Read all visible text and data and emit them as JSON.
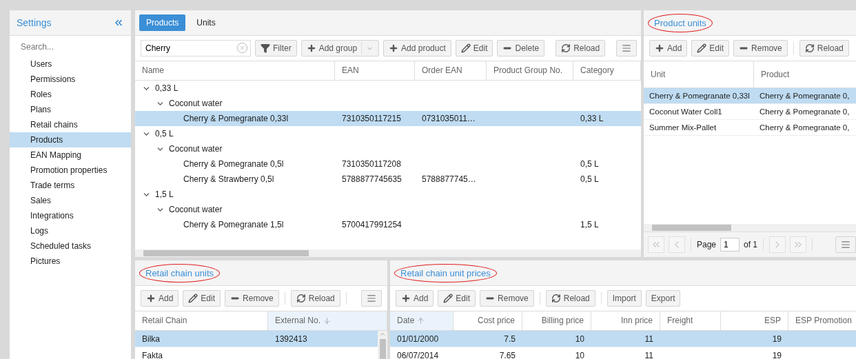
{
  "sidebar": {
    "title": "Settings",
    "search": {
      "placeholder": "Search..."
    },
    "items": [
      {
        "label": "Users",
        "selected": false
      },
      {
        "label": "Permissions",
        "selected": false
      },
      {
        "label": "Roles",
        "selected": false
      },
      {
        "label": "Plans",
        "selected": false
      },
      {
        "label": "Retail chains",
        "selected": false
      },
      {
        "label": "Products",
        "selected": true
      },
      {
        "label": "EAN Mapping",
        "selected": false
      },
      {
        "label": "Promotion properties",
        "selected": false
      },
      {
        "label": "Trade terms",
        "selected": false
      },
      {
        "label": "Sales",
        "selected": false
      },
      {
        "label": "Integrations",
        "selected": false
      },
      {
        "label": "Logs",
        "selected": false
      },
      {
        "label": "Scheduled tasks",
        "selected": false
      },
      {
        "label": "Pictures",
        "selected": false
      }
    ]
  },
  "products": {
    "tabs": [
      {
        "label": "Products",
        "selected": true
      },
      {
        "label": "Units",
        "selected": false
      }
    ],
    "search": {
      "value": "Cherry"
    },
    "toolbar": [
      {
        "kind": "filter",
        "label": "Filter"
      },
      {
        "kind": "add",
        "label": "Add group",
        "dropdown": true
      },
      {
        "kind": "add",
        "label": "Add product"
      },
      {
        "kind": "edit",
        "label": "Edit"
      },
      {
        "kind": "remove",
        "label": "Delete"
      },
      {
        "kind": "separator"
      },
      {
        "kind": "reload",
        "label": "Reload"
      },
      {
        "kind": "separator"
      },
      {
        "kind": "menu"
      }
    ],
    "columns": [
      {
        "label": "Name"
      },
      {
        "label": "EAN"
      },
      {
        "label": "Order EAN"
      },
      {
        "label": "Product Group No."
      },
      {
        "label": "Category"
      }
    ],
    "tree": [
      {
        "cells": [
          "0,33 L"
        ],
        "expanded": true,
        "children": [
          {
            "cells": [
              "Coconut water"
            ],
            "expanded": true,
            "children": [
              {
                "cells": [
                  "Cherry & Pomegranate 0,33l",
                  "7310350117215",
                  "0731035011…",
                  null,
                  "0,33 L"
                ],
                "selected": true
              }
            ]
          }
        ]
      },
      {
        "cells": [
          "0,5 L"
        ],
        "expanded": true,
        "children": [
          {
            "cells": [
              "Coconut water"
            ],
            "expanded": true,
            "children": [
              {
                "cells": [
                  "Cherry & Pomegranate 0,5l",
                  "7310350117208",
                  null,
                  null,
                  "0,5 L"
                ],
                "selected": false
              },
              {
                "cells": [
                  "Cherry & Strawberry 0,5l",
                  "5788877745635",
                  "5788877745…",
                  null,
                  "0,5 L"
                ],
                "selected": false
              }
            ]
          }
        ]
      },
      {
        "cells": [
          "1,5 L"
        ],
        "expanded": true,
        "children": [
          {
            "cells": [
              "Coconut water"
            ],
            "expanded": true,
            "children": [
              {
                "cells": [
                  "Cherry & Pomegranate 1,5l",
                  "5700417991254",
                  null,
                  null,
                  "1,5 L"
                ],
                "selected": false
              }
            ]
          }
        ]
      }
    ]
  },
  "product_units": {
    "title": "Product units",
    "annotated": true,
    "toolbar": [
      {
        "kind": "add",
        "label": "Add"
      },
      {
        "kind": "edit",
        "label": "Edit"
      },
      {
        "kind": "remove",
        "label": "Remove"
      },
      {
        "kind": "separator"
      },
      {
        "kind": "reload",
        "label": "Reload"
      }
    ],
    "columns": [
      {
        "label": "Unit"
      },
      {
        "label": "Product"
      }
    ],
    "rows": [
      {
        "cells": [
          "Cherry & Pomegranate 0,33l",
          "Cherry & Pomegranate 0,"
        ],
        "selected": true
      },
      {
        "cells": [
          "Coconut Water Coll1",
          "Cherry & Pomegranate 0,"
        ],
        "selected": false
      },
      {
        "cells": [
          "Summer Mix-Pallet",
          "Cherry & Pomegranate 0,"
        ],
        "selected": false
      }
    ],
    "pager": {
      "label": "Page",
      "page": "1",
      "total": "of 1"
    }
  },
  "retail_chain_units": {
    "title": "Retail chain units",
    "annotated": true,
    "toolbar": [
      {
        "kind": "add",
        "label": "Add"
      },
      {
        "kind": "edit",
        "label": "Edit"
      },
      {
        "kind": "remove",
        "label": "Remove"
      },
      {
        "kind": "separator"
      },
      {
        "kind": "reload",
        "label": "Reload"
      },
      {
        "kind": "separator"
      },
      {
        "kind": "menu"
      }
    ],
    "columns": [
      {
        "label": "Retail Chain"
      },
      {
        "label": "External No.",
        "sorted": true,
        "ascending": false
      }
    ],
    "rows": [
      {
        "cells": [
          "Bilka",
          "1392413"
        ],
        "selected": true
      },
      {
        "cells": [
          "Fakta",
          null
        ],
        "selected": false
      }
    ]
  },
  "retail_chain_unit_prices": {
    "title": "Retail chain unit prices",
    "annotated": true,
    "toolbar": [
      {
        "kind": "add",
        "label": "Add"
      },
      {
        "kind": "edit",
        "label": "Edit"
      },
      {
        "kind": "remove",
        "label": "Remove"
      },
      {
        "kind": "separator"
      },
      {
        "kind": "reload",
        "label": "Reload"
      },
      {
        "kind": "separator"
      },
      {
        "kind": "plain",
        "label": "Import"
      },
      {
        "kind": "plain",
        "label": "Export"
      }
    ],
    "columns": [
      {
        "label": "Date",
        "sorted": true,
        "ascending": true
      },
      {
        "label": "Cost price"
      },
      {
        "label": "Billing price"
      },
      {
        "label": "Inn price"
      },
      {
        "label": "Freight"
      },
      {
        "label": "ESP"
      },
      {
        "label": "ESP Promotion"
      }
    ],
    "rows": [
      {
        "cells": [
          "01/01/2000",
          "7.5",
          "10",
          "11",
          null,
          "19",
          null
        ],
        "selected": true
      },
      {
        "cells": [
          "06/07/2014",
          "7.65",
          "10",
          "11",
          null,
          "19",
          null
        ],
        "selected": false
      }
    ]
  }
}
